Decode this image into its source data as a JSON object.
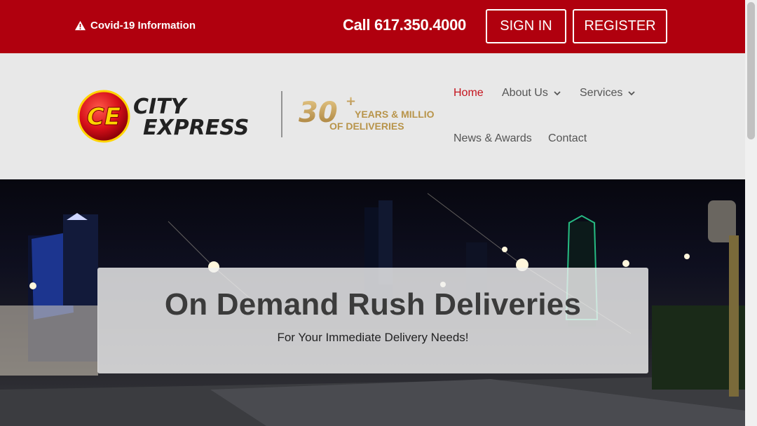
{
  "topbar": {
    "covid_label": "Covid-19 Information",
    "call_label": "Call 617.350.4000",
    "signin_label": "SIGN IN",
    "register_label": "REGISTER"
  },
  "logo": {
    "initials": "CE",
    "city": "CITY",
    "express": "EXPRESS",
    "years_number": "30",
    "years_plus": "+",
    "years_line1": "YEARS & MILLIONS",
    "years_line2": "OF DELIVERIES"
  },
  "nav": {
    "home": "Home",
    "about": "About Us",
    "services": "Services",
    "news": "News & Awards",
    "contact": "Contact"
  },
  "hero": {
    "title": "On Demand Rush Deliveries",
    "subtitle": "For Your Immediate  Delivery Needs!"
  },
  "colors": {
    "brand_red": "#b0000e",
    "nav_active": "#c4131d",
    "gold": "#b8944a"
  }
}
